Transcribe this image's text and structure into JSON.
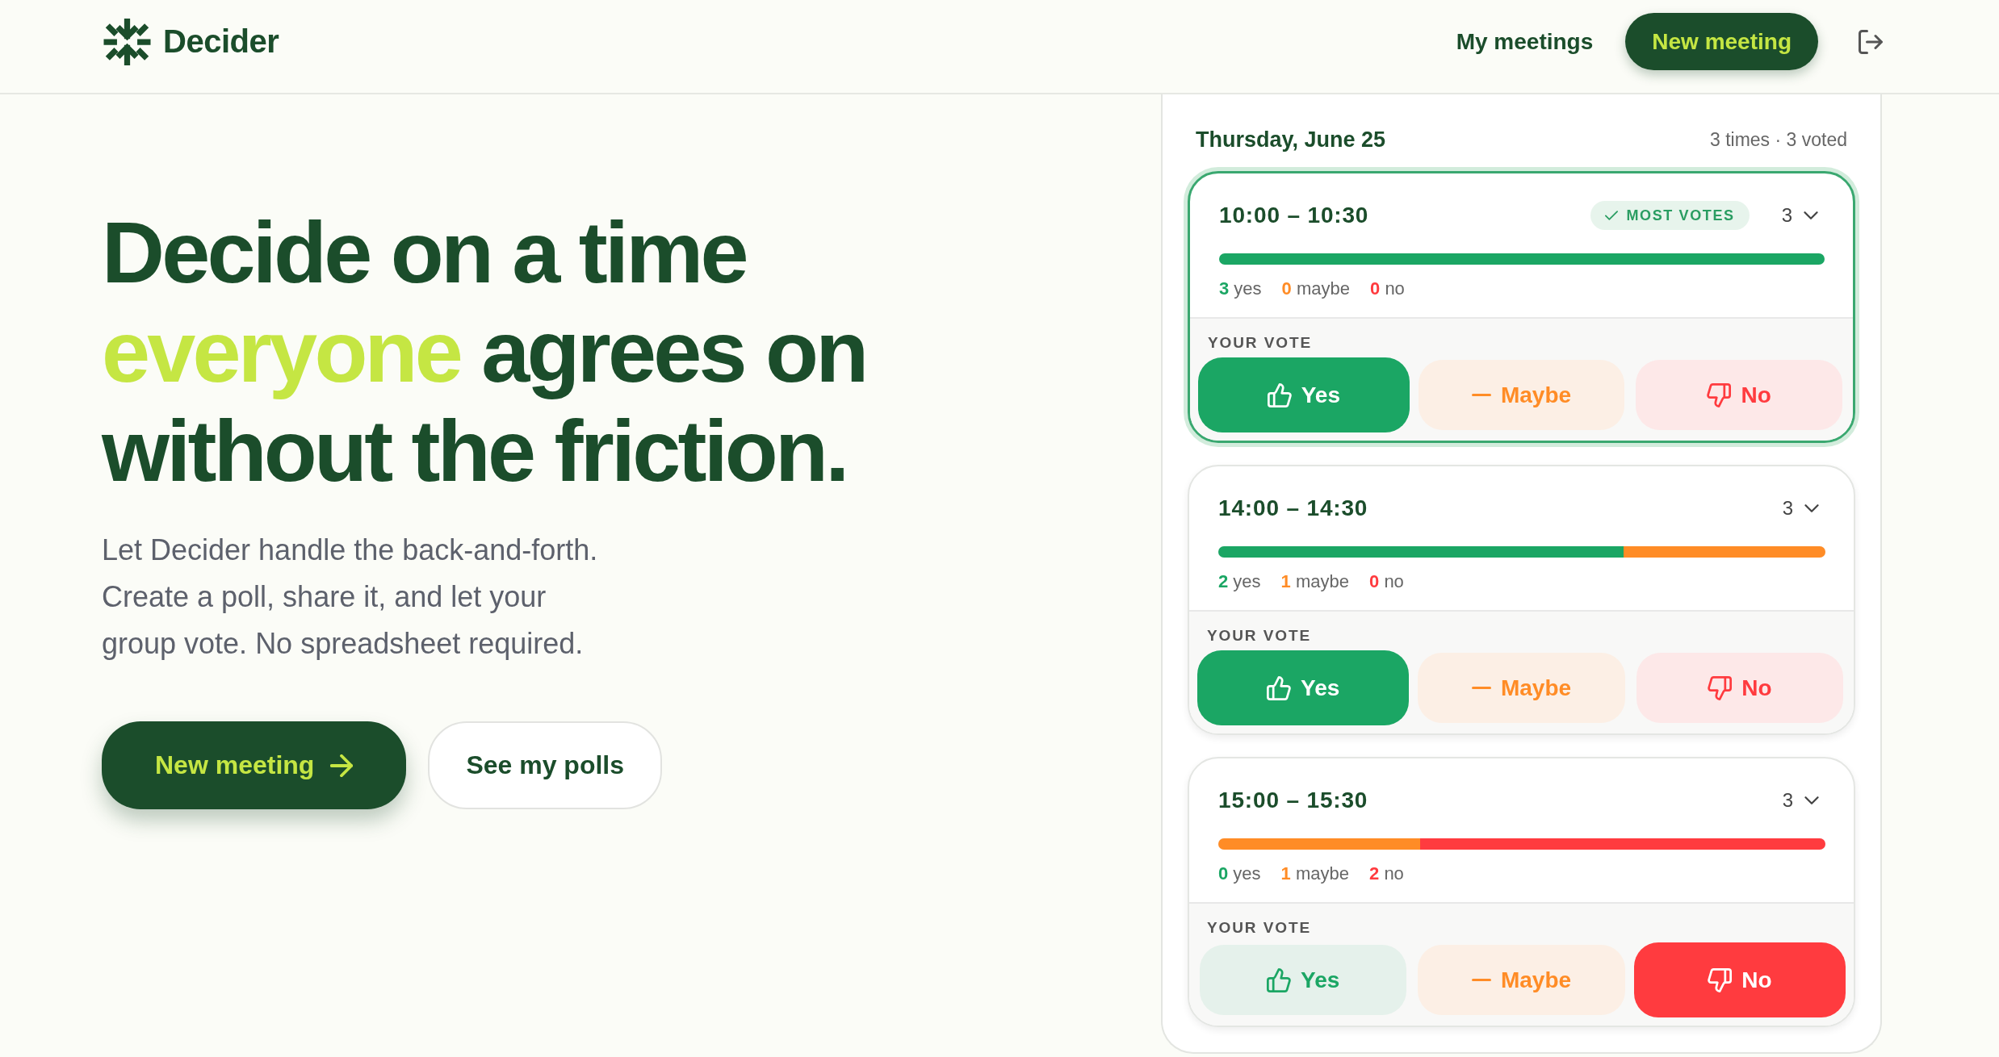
{
  "header": {
    "brand": "Decider",
    "nav": [
      {
        "label": "My meetings"
      }
    ],
    "button": "New meeting"
  },
  "hero": {
    "headline": [
      {
        "text": "Decide on a time",
        "accent": false
      },
      {
        "text": "everyone",
        "accent": true
      },
      {
        "text": "agrees on without the friction.",
        "accent": false
      }
    ],
    "intro": "Let Decider handle the back-and-forth. Create a poll, share it, and let your group vote. No spreadsheet required.",
    "actions": [
      {
        "label": "New meeting",
        "kind": "primary"
      },
      {
        "label": "See my polls",
        "kind": "secondary"
      }
    ]
  },
  "schedule": {
    "date": "Thursday, June 25",
    "summary": "3 times · 3 voted",
    "slots": [
      {
        "time": "10:00 – 10:30",
        "highlighted": true,
        "badge": "MOST VOTES",
        "voters": "3",
        "tally": [
          {
            "kind": "yes",
            "count": "3",
            "label": "yes",
            "level": 1
          },
          {
            "kind": "maybe",
            "count": "0",
            "label": "maybe"
          },
          {
            "kind": "no",
            "count": "0",
            "label": "no"
          }
        ],
        "vote_label": "YOUR VOTE",
        "options": [
          {
            "kind": "yes",
            "label": "Yes",
            "selected": true
          },
          {
            "kind": "maybe",
            "label": "Maybe",
            "selected": false
          },
          {
            "kind": "no",
            "label": "No",
            "selected": false
          }
        ]
      },
      {
        "time": "14:00 – 14:30",
        "highlighted": false,
        "voters": "3",
        "tally": [
          {
            "kind": "yes",
            "count": "2",
            "label": "yes",
            "level": 0.667
          },
          {
            "kind": "maybe",
            "count": "1",
            "label": "maybe",
            "level": 0.333
          },
          {
            "kind": "no",
            "count": "0",
            "label": "no"
          }
        ],
        "vote_label": "YOUR VOTE",
        "options": [
          {
            "kind": "yes",
            "label": "Yes",
            "selected": true
          },
          {
            "kind": "maybe",
            "label": "Maybe",
            "selected": false
          },
          {
            "kind": "no",
            "label": "No",
            "selected": false
          }
        ]
      },
      {
        "time": "15:00 – 15:30",
        "highlighted": false,
        "voters": "3",
        "tally": [
          {
            "kind": "yes",
            "count": "0",
            "label": "yes"
          },
          {
            "kind": "maybe",
            "count": "1",
            "label": "maybe",
            "level": 0.333
          },
          {
            "kind": "no",
            "count": "2",
            "label": "no",
            "level": 0.667
          }
        ],
        "vote_label": "YOUR VOTE",
        "options": [
          {
            "kind": "yes",
            "label": "Yes",
            "selected": false
          },
          {
            "kind": "maybe",
            "label": "Maybe",
            "selected": false
          },
          {
            "kind": "no",
            "label": "No",
            "selected": true
          }
        ]
      }
    ]
  }
}
